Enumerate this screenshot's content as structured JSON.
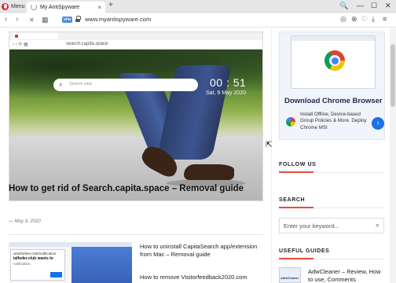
{
  "browser": {
    "menu_label": "Menu",
    "tab_title": "My AntiSpyware",
    "tab_close": "×",
    "new_tab": "+",
    "url": "www.myantispyware.com",
    "vpn_badge": "VPN",
    "window_controls": [
      "🔍",
      "—",
      "☐",
      "✕"
    ],
    "nav": {
      "back": "‹",
      "forward": "›",
      "reload_stop": "✕",
      "speed_dial": "▦"
    },
    "right_icons": [
      "camera-icon",
      "wallet-icon",
      "heart-icon",
      "menu-icon",
      "download-icon",
      "easy-setup-icon"
    ]
  },
  "hero": {
    "inner_url": "search.capita.space",
    "search_placeholder": "Search web",
    "clock": "00 : 51",
    "date": "Sat, 9 May 2020"
  },
  "article": {
    "title": "How to get rid of Search.capita.space – Removal guide",
    "date": "— May 9, 2020"
  },
  "related": {
    "thumb": {
      "domain": "ainsthefeer.club/notification",
      "wants": "ialfeder.club wants to",
      "notif": "notification"
    },
    "links": [
      "How to uninstall CapitaSearch app/extension from Mac – Removal guide",
      "How to remove Visitorfeedback2020.com"
    ]
  },
  "sidebar": {
    "ad": {
      "title": "Download Chrome Browser",
      "desc": "Install Offline, Device-based Group Policies & More. Deploy Chrome MSI",
      "arrow": "›"
    },
    "follow_us": "FOLLOW US",
    "search_heading": "SEARCH",
    "search_placeholder": "Enter your keyword...",
    "useful_guides": "USEFUL GUIDES",
    "guide_thumb_text": "AdwCleaner",
    "guide_link": "AdwCleaner – Review, How to use, Comments"
  },
  "colors": {
    "accent_red": "#e84a3d",
    "opera_red": "#e2202c",
    "link_blue": "#1a73e8"
  }
}
